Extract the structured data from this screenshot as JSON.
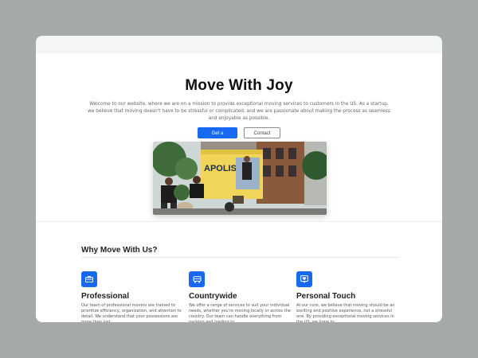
{
  "hero": {
    "title": "Move With Joy",
    "intro": "Welcome to our website, where we are on a mission to provide exceptional moving services to customers in the US. As a startup, we believe that moving doesn't have to be stressful or complicated, and we are passionate about making the process as seamless and enjoyable as possible.",
    "primary_button": "Get a Quote",
    "secondary_button": "Contact US",
    "truck_text": "APOLIS"
  },
  "why": {
    "title": "Why Move With Us?",
    "features": [
      {
        "icon": "briefcase-icon",
        "title": "Professional",
        "desc": "Our team of professional movers are trained to prioritize efficiency, organization, and attention to detail. We understand that your possessions are more than just"
      },
      {
        "icon": "truck-icon",
        "title": "Countrywide",
        "desc": "We offer a range of services to suit your individual needs, whether you're moving locally or across the country. Our team can handle everything from packing and loading to"
      },
      {
        "icon": "heart-chat-icon",
        "title": "Personal Touch",
        "desc": "At our core, we believe that moving should be an exciting and positive experience, not a stressful one. By providing exceptional moving services in the US, we hope to"
      }
    ]
  },
  "colors": {
    "accent": "#1769f2",
    "background": "#a3aaa9"
  }
}
